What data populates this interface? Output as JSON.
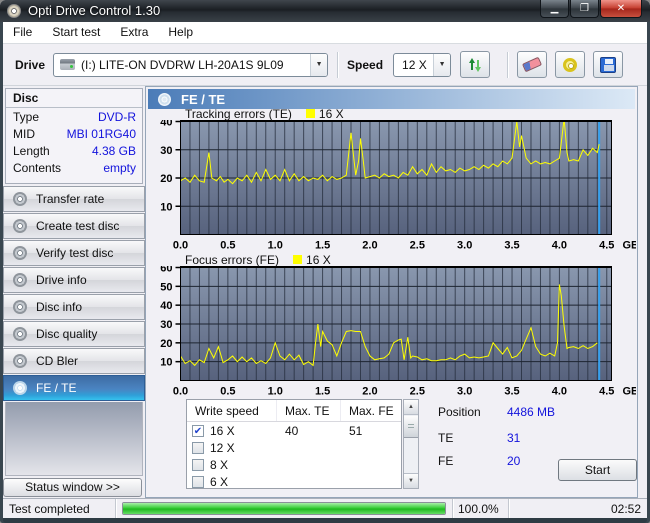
{
  "window": {
    "title": "Opti Drive Control 1.30",
    "minimize": "—",
    "maximize": "▢",
    "close": "✕"
  },
  "menu": {
    "items": [
      "File",
      "Start test",
      "Extra",
      "Help"
    ]
  },
  "toolbar": {
    "drive_label": "Drive",
    "drive_value": "(I:)   LITE-ON DVDRW LH-20A1S 9L09",
    "speed_label": "Speed",
    "speed_value": "12 X"
  },
  "disc_panel": {
    "title": "Disc",
    "rows": [
      {
        "label": "Type",
        "value": "DVD-R"
      },
      {
        "label": "MID",
        "value": "MBI 01RG40"
      },
      {
        "label": "Length",
        "value": "4.38 GB"
      },
      {
        "label": "Contents",
        "value": "empty"
      }
    ]
  },
  "sidebar": {
    "items": [
      {
        "label": "Transfer rate",
        "selected": false
      },
      {
        "label": "Create test disc",
        "selected": false
      },
      {
        "label": "Verify test disc",
        "selected": false
      },
      {
        "label": "Drive info",
        "selected": false
      },
      {
        "label": "Disc info",
        "selected": false
      },
      {
        "label": "Disc quality",
        "selected": false
      },
      {
        "label": "CD Bler",
        "selected": false
      },
      {
        "label": "FE / TE",
        "selected": true
      }
    ],
    "status_window_label": "Status window >>"
  },
  "main": {
    "header": "FE / TE"
  },
  "chart_data": [
    {
      "type": "line",
      "title": "Tracking errors (TE)",
      "legend": "16 X",
      "series_color": "#ffff00",
      "xlabel": "GB",
      "xlim": [
        0,
        4.55
      ],
      "ylim": [
        0,
        40
      ],
      "xticks": [
        0.0,
        0.5,
        1.0,
        1.5,
        2.0,
        2.5,
        3.0,
        3.5,
        4.0,
        4.5
      ],
      "yticks": [
        10,
        20,
        30,
        40
      ],
      "minor_x_step": 0.1,
      "grid": true,
      "cursor_x": 4.42,
      "cursor_color": "#34a0ee",
      "points": [
        [
          0,
          19
        ],
        [
          0.05,
          20
        ],
        [
          0.1,
          18.5
        ],
        [
          0.15,
          21
        ],
        [
          0.2,
          19
        ],
        [
          0.25,
          18.5
        ],
        [
          0.3,
          29
        ],
        [
          0.33,
          20
        ],
        [
          0.38,
          19
        ],
        [
          0.42,
          20.5
        ],
        [
          0.46,
          18.5
        ],
        [
          0.5,
          19.5
        ],
        [
          0.55,
          18
        ],
        [
          0.6,
          20
        ],
        [
          0.65,
          19
        ],
        [
          0.7,
          21
        ],
        [
          0.75,
          18.5
        ],
        [
          0.8,
          22
        ],
        [
          0.85,
          19
        ],
        [
          0.9,
          23
        ],
        [
          0.95,
          19.5
        ],
        [
          1,
          21
        ],
        [
          1.05,
          19
        ],
        [
          1.1,
          23
        ],
        [
          1.15,
          19
        ],
        [
          1.2,
          21.5
        ],
        [
          1.25,
          19
        ],
        [
          1.3,
          20.5
        ],
        [
          1.35,
          19
        ],
        [
          1.4,
          20
        ],
        [
          1.45,
          19.5
        ],
        [
          1.5,
          21
        ],
        [
          1.55,
          19
        ],
        [
          1.6,
          20.5
        ],
        [
          1.65,
          19.5
        ],
        [
          1.7,
          20
        ],
        [
          1.75,
          21
        ],
        [
          1.8,
          36
        ],
        [
          1.83,
          27
        ],
        [
          1.85,
          21
        ],
        [
          1.88,
          26
        ],
        [
          1.9,
          34
        ],
        [
          1.93,
          26
        ],
        [
          1.95,
          20
        ],
        [
          2,
          20.5
        ],
        [
          2.05,
          21
        ],
        [
          2.1,
          20
        ],
        [
          2.15,
          21.5
        ],
        [
          2.2,
          20.5
        ],
        [
          2.25,
          21
        ],
        [
          2.3,
          20
        ],
        [
          2.35,
          22
        ],
        [
          2.4,
          21
        ],
        [
          2.45,
          24
        ],
        [
          2.5,
          21.5
        ],
        [
          2.55,
          23
        ],
        [
          2.6,
          21
        ],
        [
          2.65,
          25
        ],
        [
          2.7,
          22
        ],
        [
          2.75,
          24
        ],
        [
          2.8,
          22.5
        ],
        [
          2.85,
          23
        ],
        [
          2.9,
          22
        ],
        [
          2.95,
          23.5
        ],
        [
          3,
          22.5
        ],
        [
          3.05,
          23
        ],
        [
          3.1,
          24
        ],
        [
          3.15,
          23
        ],
        [
          3.2,
          24.5
        ],
        [
          3.25,
          23.5
        ],
        [
          3.3,
          25
        ],
        [
          3.35,
          24
        ],
        [
          3.4,
          26
        ],
        [
          3.45,
          25
        ],
        [
          3.5,
          27
        ],
        [
          3.55,
          40
        ],
        [
          3.58,
          31
        ],
        [
          3.6,
          35
        ],
        [
          3.65,
          27
        ],
        [
          3.7,
          25
        ],
        [
          3.75,
          26
        ],
        [
          3.8,
          25
        ],
        [
          3.85,
          25.5
        ],
        [
          3.9,
          25
        ],
        [
          3.95,
          26
        ],
        [
          4,
          27
        ],
        [
          4.05,
          41
        ],
        [
          4.08,
          29
        ],
        [
          4.1,
          26
        ],
        [
          4.15,
          26.5
        ],
        [
          4.2,
          26
        ],
        [
          4.25,
          30
        ],
        [
          4.3,
          28
        ],
        [
          4.35,
          30.5
        ],
        [
          4.4,
          29
        ],
        [
          4.42,
          32
        ]
      ]
    },
    {
      "type": "line",
      "title": "Focus errors (FE)",
      "legend": "16 X",
      "series_color": "#ffff00",
      "xlabel": "GB",
      "xlim": [
        0,
        4.55
      ],
      "ylim": [
        0,
        60
      ],
      "xticks": [
        0.0,
        0.5,
        1.0,
        1.5,
        2.0,
        2.5,
        3.0,
        3.5,
        4.0,
        4.5
      ],
      "yticks": [
        10,
        20,
        30,
        40,
        50,
        60
      ],
      "minor_x_step": 0.1,
      "grid": true,
      "cursor_x": 4.42,
      "cursor_color": "#34a0ee",
      "points": [
        [
          0,
          13
        ],
        [
          0.05,
          9
        ],
        [
          0.1,
          10.5
        ],
        [
          0.15,
          8
        ],
        [
          0.2,
          11
        ],
        [
          0.25,
          9.5
        ],
        [
          0.3,
          17
        ],
        [
          0.35,
          12
        ],
        [
          0.4,
          18
        ],
        [
          0.45,
          9.5
        ],
        [
          0.5,
          11
        ],
        [
          0.55,
          13
        ],
        [
          0.6,
          10
        ],
        [
          0.65,
          12.5
        ],
        [
          0.7,
          10
        ],
        [
          0.75,
          12
        ],
        [
          0.8,
          9
        ],
        [
          0.85,
          10.5
        ],
        [
          0.9,
          9
        ],
        [
          0.95,
          12
        ],
        [
          1,
          20
        ],
        [
          1.05,
          13
        ],
        [
          1.1,
          11
        ],
        [
          1.15,
          14
        ],
        [
          1.2,
          11
        ],
        [
          1.25,
          13.5
        ],
        [
          1.3,
          8.5
        ],
        [
          1.35,
          10
        ],
        [
          1.4,
          8
        ],
        [
          1.43,
          22
        ],
        [
          1.45,
          30
        ],
        [
          1.48,
          18
        ],
        [
          1.5,
          26
        ],
        [
          1.55,
          21
        ],
        [
          1.6,
          19
        ],
        [
          1.65,
          13
        ],
        [
          1.7,
          20
        ],
        [
          1.75,
          26
        ],
        [
          1.8,
          26.5
        ],
        [
          1.85,
          26
        ],
        [
          1.9,
          26
        ],
        [
          1.95,
          18
        ],
        [
          2,
          13
        ],
        [
          2.05,
          11
        ],
        [
          2.1,
          11.5
        ],
        [
          2.15,
          12
        ],
        [
          2.2,
          14
        ],
        [
          2.25,
          20
        ],
        [
          2.3,
          21.5
        ],
        [
          2.33,
          22
        ],
        [
          2.36,
          11
        ],
        [
          2.4,
          23
        ],
        [
          2.43,
          12
        ],
        [
          2.45,
          13
        ],
        [
          2.5,
          12.5
        ],
        [
          2.55,
          11
        ],
        [
          2.6,
          11.5
        ],
        [
          2.65,
          10.5
        ],
        [
          2.7,
          10.5
        ],
        [
          2.75,
          11
        ],
        [
          2.8,
          11
        ],
        [
          2.85,
          12
        ],
        [
          2.9,
          11
        ],
        [
          2.95,
          13
        ],
        [
          3,
          14
        ],
        [
          3.05,
          12
        ],
        [
          3.1,
          12.5
        ],
        [
          3.15,
          12
        ],
        [
          3.2,
          12.5
        ],
        [
          3.25,
          13
        ],
        [
          3.3,
          20
        ],
        [
          3.35,
          17
        ],
        [
          3.4,
          14
        ],
        [
          3.45,
          17.5
        ],
        [
          3.5,
          12
        ],
        [
          3.55,
          13
        ],
        [
          3.6,
          16
        ],
        [
          3.65,
          22
        ],
        [
          3.7,
          28
        ],
        [
          3.75,
          18
        ],
        [
          3.8,
          14
        ],
        [
          3.85,
          13
        ],
        [
          3.9,
          14.5
        ],
        [
          3.95,
          13
        ],
        [
          3.98,
          20
        ],
        [
          4,
          51
        ],
        [
          4.02,
          45
        ],
        [
          4.05,
          29
        ],
        [
          4.08,
          17
        ],
        [
          4.1,
          17.5
        ],
        [
          4.15,
          18
        ],
        [
          4.2,
          17
        ],
        [
          4.25,
          18.5
        ],
        [
          4.3,
          17
        ],
        [
          4.35,
          18
        ],
        [
          4.4,
          20
        ]
      ]
    }
  ],
  "write_speed_table": {
    "columns": [
      "Write speed",
      "Max. TE",
      "Max. FE"
    ],
    "rows": [
      {
        "speed": "16 X",
        "checked": true,
        "max_te": "40",
        "max_fe": "51"
      },
      {
        "speed": "12 X",
        "checked": false,
        "max_te": "",
        "max_fe": ""
      },
      {
        "speed": "8 X",
        "checked": false,
        "max_te": "",
        "max_fe": ""
      },
      {
        "speed": "6 X",
        "checked": false,
        "max_te": "",
        "max_fe": ""
      }
    ]
  },
  "results": {
    "position_label": "Position",
    "position_value": "4486 MB",
    "te_label": "TE",
    "te_value": "31",
    "fe_label": "FE",
    "fe_value": "20",
    "start_label": "Start"
  },
  "status_bar": {
    "status": "Test completed",
    "progress_percent": "100.0%",
    "progress_fraction": 1.0,
    "time": "02:52"
  }
}
